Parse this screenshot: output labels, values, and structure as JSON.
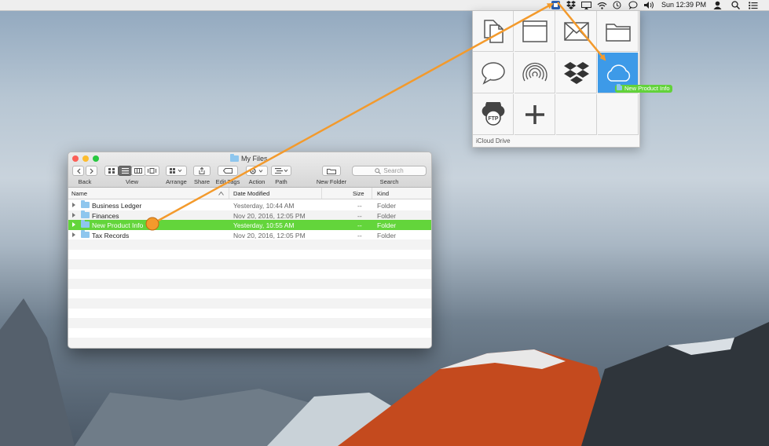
{
  "menubar": {
    "clock": "Sun 12:39 PM",
    "icons": [
      "app-icon",
      "dropbox-icon",
      "airplay-icon",
      "wifi-icon",
      "time-machine-icon",
      "messages-icon",
      "volume-icon",
      "user-icon",
      "spotlight-icon",
      "notification-center-icon"
    ]
  },
  "finder": {
    "title": "My Files",
    "toolbar": {
      "back_label": "Back",
      "view_label": "View",
      "arrange_label": "Arrange",
      "share_label": "Share",
      "edit_tags_label": "Edit Tags",
      "action_label": "Action",
      "path_label": "Path",
      "new_folder_label": "New Folder",
      "search_label": "Search",
      "search_placeholder": "Search"
    },
    "columns": {
      "name": "Name",
      "date": "Date Modified",
      "size": "Size",
      "kind": "Kind"
    },
    "rows": [
      {
        "name": "Business Ledger",
        "date": "Yesterday, 10:44 AM",
        "size": "--",
        "kind": "Folder"
      },
      {
        "name": "Finances",
        "date": "Nov 20, 2016, 12:05 PM",
        "size": "--",
        "kind": "Folder"
      },
      {
        "name": "New Product Info",
        "date": "Yesterday, 10:55 AM",
        "size": "--",
        "kind": "Folder",
        "selected": true
      },
      {
        "name": "Tax Records",
        "date": "Nov 20, 2016, 12:05 PM",
        "size": "--",
        "kind": "Folder"
      }
    ]
  },
  "panel": {
    "footer": "iCloud Drive",
    "cells": [
      "documents-icon",
      "window-icon",
      "mail-icon",
      "folder-icon",
      "messages-icon",
      "airdrop-icon",
      "dropbox-icon",
      "icloud-icon",
      "ftp-icon",
      "plus-icon",
      "",
      ""
    ],
    "active_cell": "icloud-icon"
  },
  "drag": {
    "label": "New Product Info"
  },
  "colors": {
    "selection": "#63d53b",
    "active_cell": "#3d9ae8",
    "arrow": "#f39a2c"
  }
}
